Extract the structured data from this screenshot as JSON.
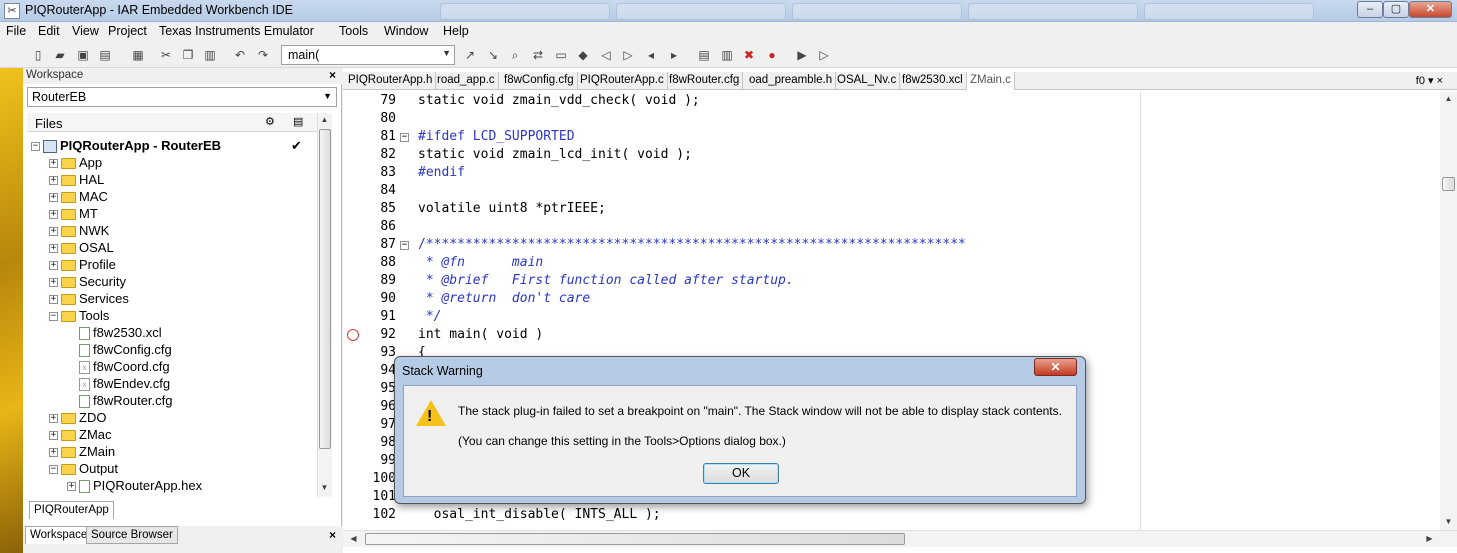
{
  "window": {
    "title": "PIQRouterApp - IAR Embedded Workbench IDE",
    "controls": {
      "minimize": "–",
      "maximize": "▢",
      "close": "✕"
    }
  },
  "menu": [
    "File",
    "Edit",
    "View",
    "Project",
    "Texas Instruments Emulator",
    "Tools",
    "Window",
    "Help"
  ],
  "toolbar": {
    "find_combo_value": "main(",
    "icons": [
      "new-file-icon",
      "open-folder-icon",
      "save-icon",
      "save-all-icon",
      "cut-icon",
      "copy-icon",
      "paste-icon",
      "undo-icon",
      "redo-icon"
    ]
  },
  "workspace": {
    "header": "Workspace",
    "close": "×",
    "config": "RouterEB",
    "files_label": "Files",
    "project": "PIQRouterApp - RouterEB",
    "check": "✔",
    "tree": [
      {
        "label": "App",
        "type": "folder",
        "exp": "+"
      },
      {
        "label": "HAL",
        "type": "folder",
        "exp": "+"
      },
      {
        "label": "MAC",
        "type": "folder",
        "exp": "+"
      },
      {
        "label": "MT",
        "type": "folder",
        "exp": "+"
      },
      {
        "label": "NWK",
        "type": "folder",
        "exp": "+"
      },
      {
        "label": "OSAL",
        "type": "folder",
        "exp": "+"
      },
      {
        "label": "Profile",
        "type": "folder",
        "exp": "+"
      },
      {
        "label": "Security",
        "type": "folder",
        "exp": "+"
      },
      {
        "label": "Services",
        "type": "folder",
        "exp": "+"
      },
      {
        "label": "Tools",
        "type": "folder",
        "exp": "−"
      },
      {
        "label": "f8w2530.xcl",
        "type": "file",
        "indent": 1
      },
      {
        "label": "f8wConfig.cfg",
        "type": "file",
        "indent": 1
      },
      {
        "label": "f8wCoord.cfg",
        "type": "file-x",
        "indent": 1
      },
      {
        "label": "f8wEndev.cfg",
        "type": "file-x",
        "indent": 1
      },
      {
        "label": "f8wRouter.cfg",
        "type": "file",
        "indent": 1
      },
      {
        "label": "ZDO",
        "type": "folder",
        "exp": "+"
      },
      {
        "label": "ZMac",
        "type": "folder",
        "exp": "+"
      },
      {
        "label": "ZMain",
        "type": "folder",
        "exp": "+"
      },
      {
        "label": "Output",
        "type": "folder",
        "exp": "−"
      },
      {
        "label": "PIQRouterApp.hex",
        "type": "file",
        "indent": 1,
        "exp": "+"
      }
    ],
    "project_tab": "PIQRouterApp",
    "bottom_tabs": [
      "Workspace",
      "Source Browser"
    ]
  },
  "editor": {
    "tabs": [
      "PIQRouterApp.h",
      "road_app.c",
      "f8wConfig.cfg",
      "PIQRouterApp.c",
      "f8wRouter.cfg",
      "oad_preamble.h",
      "OSAL_Nv.c",
      "f8w2530.xcl",
      "ZMain.c"
    ],
    "active_tab": "ZMain.c",
    "func_dropdown": "f0 ▾ ×",
    "lines": [
      {
        "n": "79",
        "text": "static void zmain_vdd_check( void );",
        "cls": "kw"
      },
      {
        "n": "80",
        "text": "",
        "cls": "kw"
      },
      {
        "n": "81",
        "text": "#ifdef LCD_SUPPORTED",
        "cls": "pp",
        "fold": "−"
      },
      {
        "n": "82",
        "text": "static void zmain_lcd_init( void );",
        "cls": "kw"
      },
      {
        "n": "83",
        "text": "#endif",
        "cls": "pp"
      },
      {
        "n": "84",
        "text": "",
        "cls": "kw"
      },
      {
        "n": "85",
        "text": "volatile uint8 *ptrIEEE;",
        "cls": "kw"
      },
      {
        "n": "86",
        "text": "",
        "cls": "kw"
      },
      {
        "n": "87",
        "text": "/*********************************************************************",
        "cls": "pp",
        "fold": "−"
      },
      {
        "n": "88",
        "text": " * @fn      main",
        "cls": "cm"
      },
      {
        "n": "89",
        "text": " * @brief   First function called after startup.",
        "cls": "cm"
      },
      {
        "n": "90",
        "text": " * @return  don't care",
        "cls": "cm"
      },
      {
        "n": "91",
        "text": " */",
        "cls": "cm"
      },
      {
        "n": "92",
        "text": "int main( void )",
        "cls": "kw"
      },
      {
        "n": "93",
        "text": "{",
        "cls": "kw"
      },
      {
        "n": "94",
        "text": "",
        "cls": "kw"
      },
      {
        "n": "95",
        "text": "",
        "cls": "kw"
      },
      {
        "n": "96",
        "text": "",
        "cls": "kw"
      },
      {
        "n": "97",
        "text": "",
        "cls": "kw"
      },
      {
        "n": "98",
        "text": "",
        "cls": "kw"
      },
      {
        "n": "99",
        "text": "",
        "cls": "kw"
      },
      {
        "n": "100",
        "text": "",
        "cls": "kw"
      },
      {
        "n": "101",
        "text": "",
        "cls": "kw"
      },
      {
        "n": "102",
        "text": "  osal_int_disable( INTS_ALL );",
        "cls": "kw"
      }
    ]
  },
  "dialog": {
    "title": "Stack Warning",
    "close": "✕",
    "message": "The stack plug-in failed to set a breakpoint on \"main\". The Stack window will not be able to display stack contents.",
    "hint": "(You can change this setting in the Tools>Options dialog box.)",
    "ok": "OK",
    "warn_mark": "!"
  }
}
